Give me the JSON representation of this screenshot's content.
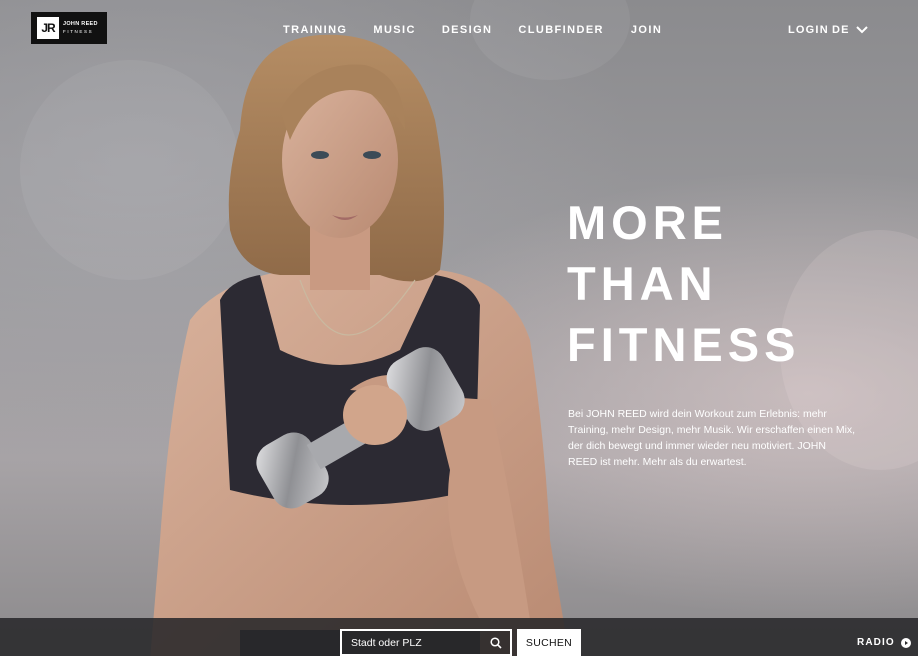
{
  "brand": {
    "logo_mark": "JR",
    "logo_name": "JOHN REED",
    "logo_sub": "FITNESS"
  },
  "nav": {
    "items": [
      {
        "label": "TRAINING"
      },
      {
        "label": "MUSIC"
      },
      {
        "label": "DESIGN"
      },
      {
        "label": "CLUBFINDER"
      },
      {
        "label": "JOIN"
      }
    ],
    "login": "LOGIN",
    "language": "DE"
  },
  "hero": {
    "headline": [
      "MORE",
      "THAN",
      "FITNESS"
    ],
    "description": "Bei JOHN REED wird dein Workout zum Erlebnis: mehr Training, mehr Design, mehr Musik. Wir erschaffen einen Mix, der dich bewegt und immer wieder neu motiviert. JOHN REED ist mehr. Mehr als du erwartest."
  },
  "finder": {
    "placeholder": "Stadt oder PLZ",
    "value": "",
    "button_label": "SUCHEN"
  },
  "radio": {
    "label": "RADIO"
  },
  "icons": {
    "search": "search-icon",
    "language": "chevron-down-icon",
    "radio": "play-circle-icon"
  },
  "colors": {
    "text": "#ffffff",
    "bar": "#2a2a2c",
    "logo_bg": "#111111"
  }
}
